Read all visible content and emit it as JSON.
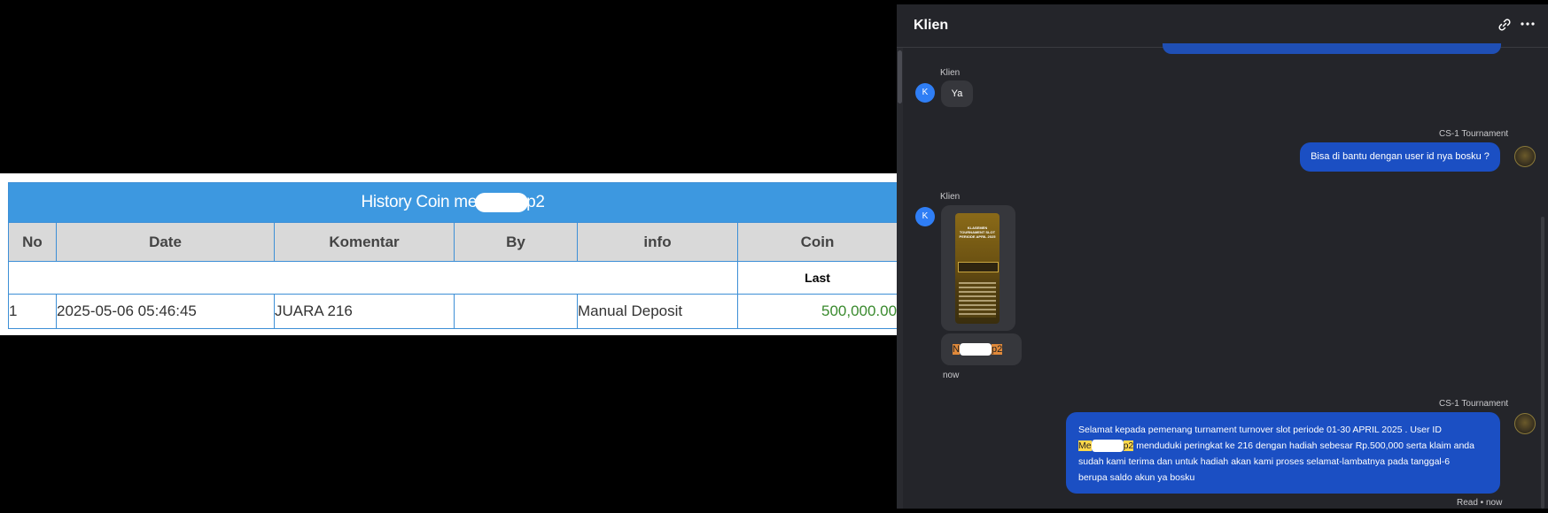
{
  "history": {
    "title_prefix": "History Coin me",
    "title_suffix": "p2",
    "columns": [
      "No",
      "Date",
      "Komentar",
      "By",
      "info",
      "Coin"
    ],
    "sub_label": "Last",
    "rows": [
      {
        "no": "1",
        "date": "2025-05-06 05:46:45",
        "komentar": "JUARA 216",
        "by": "",
        "info": "Manual Deposit",
        "coin": "500,000.00"
      }
    ]
  },
  "chat": {
    "title": "Klien",
    "header_icons": [
      "link-icon",
      "more-icon"
    ],
    "messages": [
      {
        "sender": "Klien",
        "avatar": "K",
        "text": "Ya"
      },
      {
        "sender": "CS-1 Tournament",
        "text": "Bisa di bantu dengan user id nya bosku ?"
      },
      {
        "sender": "Klien",
        "avatar": "K",
        "image_text": "KLASEMEN TOURNAMENT SLOT PERIODE APRIL 2025",
        "user_prefix": "N",
        "user_suffix": "p2",
        "time": "now"
      },
      {
        "sender": "CS-1 Tournament",
        "text_part1": "Selamat kepada pemenang turnament turnover slot periode 01-30 APRIL 2025 . User ID",
        "user_prefix": "Me",
        "user_suffix": "p2",
        "text_part2": " menduduki peringkat ke 216 dengan hadiah sebesar Rp.500,000 serta klaim anda",
        "text_part3": "sudah kami terima dan untuk hadiah akan kami proses selamat-lambatnya pada tanggal-6",
        "text_part4": "berupa saldo akun ya bosku",
        "status": "Read • now"
      }
    ]
  },
  "colors": {
    "table_header_blue": "#3d98e0",
    "coin_green": "#3a8a2e",
    "chat_bg": "#24252a",
    "outgoing_bubble": "#1b4fc3",
    "avatar_blue": "#2f7ef5",
    "highlight_yellow": "#ffd84a"
  }
}
